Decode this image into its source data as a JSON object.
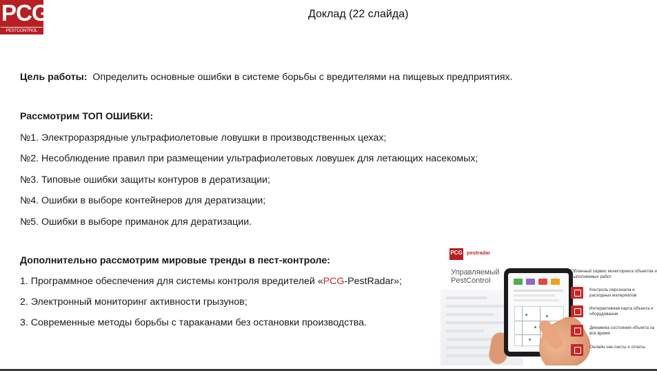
{
  "logo": {
    "big": "PCG",
    "small": "PESTCONTROL GROUP"
  },
  "title": "Доклад  (22 слайда)",
  "goal": {
    "label": "Цель работы:",
    "text": "  Определить основные ошибки в системе борьбы с вредителями на пищевых предприятиях."
  },
  "top_errors": {
    "heading": "Рассмотрим ТОП ОШИБКИ:",
    "items": [
      "№1. Электроразрядные ультрафиолетовые ловушки в производственных цехах;",
      "№2. Несоблюдение правил при размещении ультрафиолетовых ловушек для летающих насекомых;",
      "№3. Типовые ошибки защиты контуров в дератизации;",
      "№4. Ошибки в выборе контейнеров для дератизации;",
      "№5. Ошибки в выборе приманок для дератизации."
    ]
  },
  "trends": {
    "heading": "Дополнительно рассмотрим мировые тренды в пест-контроле:",
    "item1_prefix": "1. Программное обеспечения для системы контроля вредителей «",
    "item1_red": "PCG",
    "item1_middle": "-PestRadar",
    "item1_suffix": "»;",
    "item2": "2. Электронный мониторинг активности грызунов;",
    "item3": "3. Современные методы борьбы с тараканами без остановки производства."
  },
  "promo": {
    "pcg": "PCG",
    "pestradar": "pestradar",
    "heading_line1": "Управляемый",
    "heading_line2": "PestControl",
    "cloud_title": "Облачный сервис мониторинга объектов и выполняемых работ",
    "features": [
      "Контроль персонала и расходных материалов",
      "Интерактивная карта объекта и оборудования",
      "Динамика состояния объекта за все время",
      "Онлайн чек-листы и отчеты"
    ],
    "colors": {
      "brand_red": "#b52024",
      "tile_green": "#4caf50",
      "tile_purple": "#8e6ac8",
      "tile_red": "#e04848",
      "tile_orange": "#f0a020"
    }
  }
}
